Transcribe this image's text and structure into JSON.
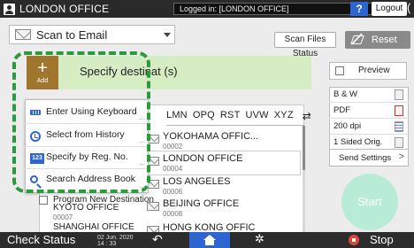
{
  "topbar": {
    "user_label": "LONDON OFFICE",
    "login_status": "Logged in: [LONDON OFFICE]",
    "help_label": "?",
    "logout_label": "Logout",
    "extra_glyph": "("
  },
  "function_select": {
    "value": "Scan to Email"
  },
  "scan_files_status_label": "Scan Files Status",
  "reset_label": "Reset",
  "destination": {
    "add_plus": "+",
    "add_label": "Add",
    "title": "Specify destinat (s)"
  },
  "menu": {
    "items": [
      {
        "label": "Enter Using Keyboard",
        "icon": "keyboard-icon"
      },
      {
        "label": "Select from History",
        "icon": "history-clock-icon"
      },
      {
        "label": "Specify by Reg. No.",
        "icon": "reg-number-icon",
        "icon_text": "123"
      },
      {
        "label": "Search Address Book",
        "icon": "search-icon"
      }
    ],
    "more": "..."
  },
  "tabs": [
    "LMN",
    "OPQ",
    "RST",
    "UVW",
    "XYZ"
  ],
  "tab_swap": "⇄",
  "entries_right": [
    {
      "name": "YOKOHAMA OFFIC...",
      "number": "00002"
    },
    {
      "name": "LONDON OFFICE",
      "number": "00004"
    },
    {
      "name": "LOS ANGELES",
      "number": "00006"
    },
    {
      "name": "BEIJING OFFICE",
      "number": "00008"
    },
    {
      "name": "HONG KONG OFFIC",
      "number": ""
    }
  ],
  "entries_left": [
    {
      "name": "Program New Destination",
      "number": ""
    },
    {
      "name": "KYOTO OFFICE",
      "number": "00007"
    },
    {
      "name": "SHANGHAI OFFICE",
      "number": ""
    }
  ],
  "preview_label": "Preview",
  "settings": [
    {
      "label": "B & W",
      "icon": "bw-icon"
    },
    {
      "label": "PDF",
      "icon": "pdf-icon"
    },
    {
      "label": "200 dpi",
      "icon": "resolution-icon"
    },
    {
      "label": "1 Sided Orig.",
      "icon": "one-sided-icon"
    }
  ],
  "send_settings_label": "Send Settings",
  "start_label": "Start",
  "bottombar": {
    "check_status": "Check Status",
    "date": "02 Jun. 2020",
    "time": "14 : 33",
    "back_glyph": "↶",
    "gear_glyph": "✲",
    "stop_label": "Stop"
  },
  "colors": {
    "accent_blue": "#2e66d1",
    "highlight_green": "#2a9a3c",
    "add_button": "#a0762f",
    "dest_bar": "#d6ecc3",
    "start_button": "#b9ecd6",
    "stop_red": "#e0453a"
  }
}
